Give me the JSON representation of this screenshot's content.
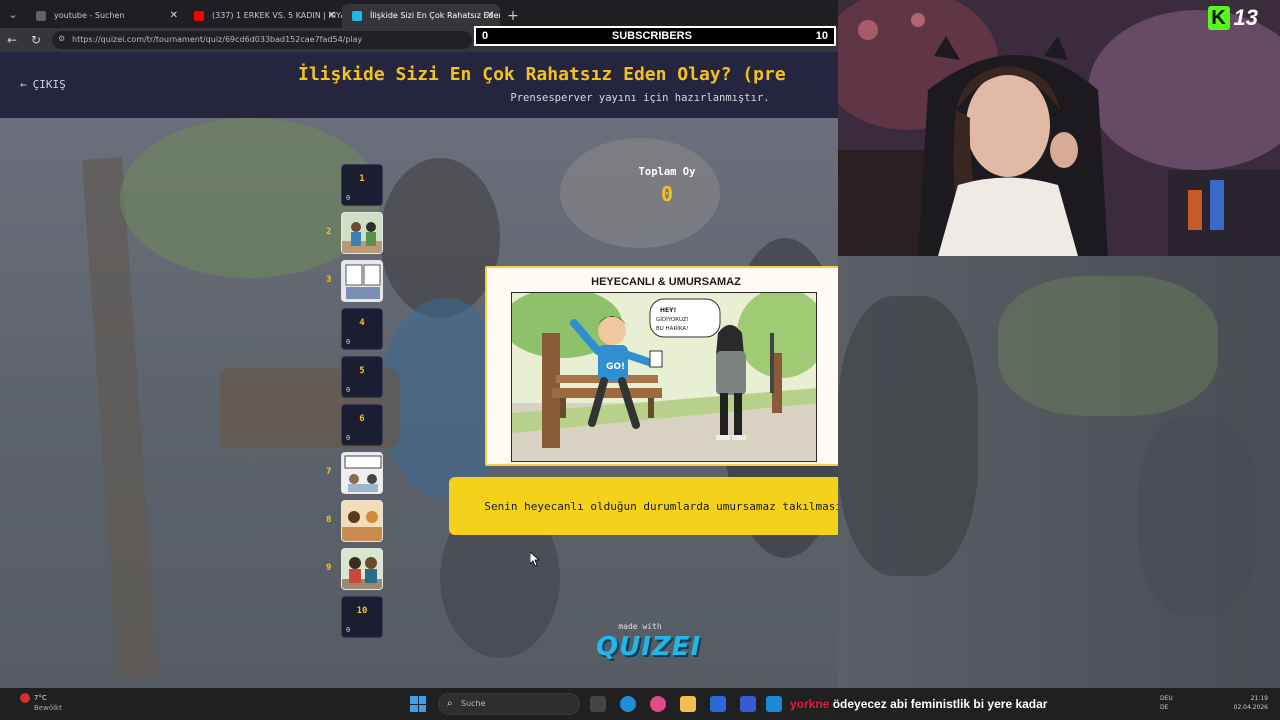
{
  "browser": {
    "tabs": [
      {
        "title": "youtube - Suchen",
        "active": false
      },
      {
        "title": "(337) 1 ERKEK VS. 5 KADIN | KIYAF",
        "active": false
      },
      {
        "title": "İlişkide Sizi En Çok Rahatsız Eden",
        "active": true
      }
    ],
    "url": "https://quizei.com/tr/tournament/quiz/69cd6d033bad152cae7fad54/play"
  },
  "subscribers": {
    "label": "SUBSCRIBERS",
    "current": "0",
    "goal": "10"
  },
  "quiz": {
    "exit_label": "ÇIKIŞ",
    "title": "İlişkide Sizi En Çok Rahatsız Eden Olay? (pre",
    "subtitle": "Prensesperver yayını için hazırlanmıştır.",
    "total_votes_label": "Toplam Oy",
    "total_votes_value": "0",
    "slots": [
      {
        "num": "1",
        "count": "0",
        "has_image": false
      },
      {
        "num": "2",
        "count": "",
        "has_image": true
      },
      {
        "num": "3",
        "count": "",
        "has_image": true
      },
      {
        "num": "4",
        "count": "0",
        "has_image": false
      },
      {
        "num": "5",
        "count": "0",
        "has_image": false
      },
      {
        "num": "6",
        "count": "0",
        "has_image": false
      },
      {
        "num": "7",
        "count": "",
        "has_image": true
      },
      {
        "num": "8",
        "count": "",
        "has_image": true
      },
      {
        "num": "9",
        "count": "",
        "has_image": true
      },
      {
        "num": "10",
        "count": "0",
        "has_image": false
      }
    ],
    "card_title": "HEYECANLI & UMURSAMAZ",
    "card_speech": "HEY! GİDİYORUZ! BU HARİKA!",
    "card_shirt": "GO!",
    "caption": "Senin heyecanlı olduğun durumlarda umursamaz takılması.",
    "made_with": "made with",
    "logo": "QUIZEI"
  },
  "webcam": {
    "badge_number": "13"
  },
  "taskbar": {
    "weather_temp": "7°C",
    "weather_cond": "Bewölkt",
    "search_placeholder": "Suche",
    "ticker_red": "yorkne",
    "ticker_text": "ödeyecez abi feministlik bi yere kadar",
    "lang": "DEU",
    "lang2": "DE",
    "time": "21:19",
    "date": "02.04.2026"
  },
  "colors": {
    "accent_yellow": "#f4c21e",
    "header_bg": "#25253f",
    "caption_bg": "#f5d21a",
    "logo_blue": "#1fb8e8"
  }
}
